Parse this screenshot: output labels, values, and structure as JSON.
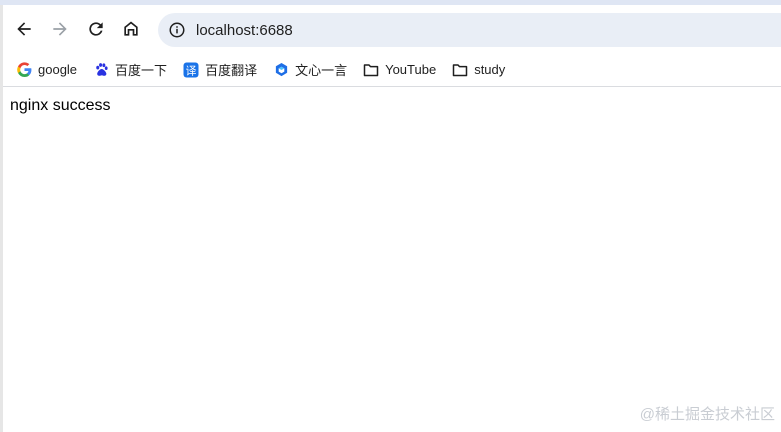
{
  "browser": {
    "address": "localhost:6688",
    "bookmarks": [
      {
        "label": "google",
        "icon": "google-icon"
      },
      {
        "label": "百度一下",
        "icon": "baidu-paw-icon"
      },
      {
        "label": "百度翻译",
        "icon": "baidu-translate-icon"
      },
      {
        "label": "文心一言",
        "icon": "wenxin-cube-icon"
      },
      {
        "label": "YouTube",
        "icon": "folder-icon"
      },
      {
        "label": "study",
        "icon": "folder-icon"
      }
    ]
  },
  "page": {
    "body_text": "nginx success"
  },
  "watermark": "@稀土掘金技术社区",
  "colors": {
    "omnibox_bg": "#e9eef6",
    "top_strip": "#dfe6f4",
    "baidu_blue": "#2932e1",
    "translate_blue": "#1a73e8"
  }
}
